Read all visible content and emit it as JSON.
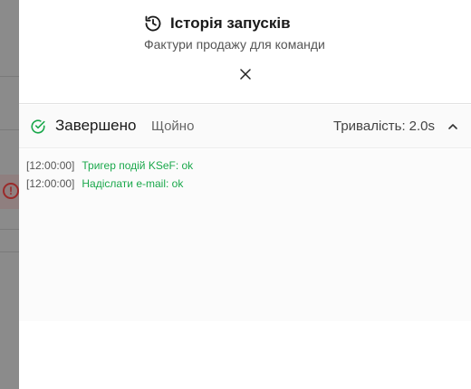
{
  "drawer": {
    "title": "Історія запусків",
    "subtitle": "Фактури продажу для команди",
    "close_icon": "close-icon",
    "history_icon": "history-icon"
  },
  "run": {
    "status": "Завершено",
    "status_icon": "check-circle-icon",
    "status_color": "#1aa84b",
    "time_ago": "Щойно",
    "duration_label": "Тривалість:",
    "duration_value": "2.0s",
    "expanded": true
  },
  "logs": [
    {
      "time": "[12:00:00]",
      "message": "Тригер подій KSeF: ok"
    },
    {
      "time": "[12:00:00]",
      "message": "Надіслати e-mail: ok"
    }
  ],
  "colors": {
    "success": "#1aa84b",
    "error": "#9a2a2a"
  }
}
